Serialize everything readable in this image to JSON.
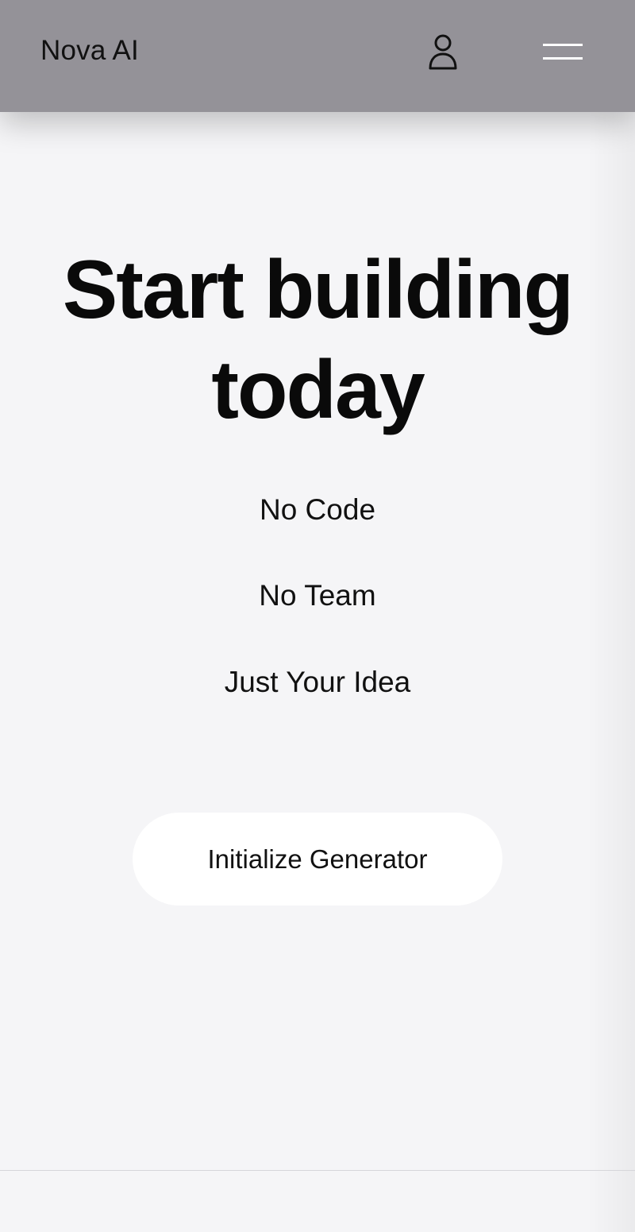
{
  "header": {
    "brand": "Nova AI",
    "icons": {
      "account": "user-icon",
      "menu": "hamburger-menu-icon"
    }
  },
  "hero": {
    "title_line1": "Start building",
    "title_line2": "today",
    "taglines": [
      "No Code",
      "No Team",
      "Just Your Idea"
    ]
  },
  "cta": {
    "label": "Initialize Generator"
  },
  "colors": {
    "header_bg": "#949298",
    "page_bg": "#f5f5f7",
    "button_bg": "#ffffff",
    "text": "#111111"
  }
}
